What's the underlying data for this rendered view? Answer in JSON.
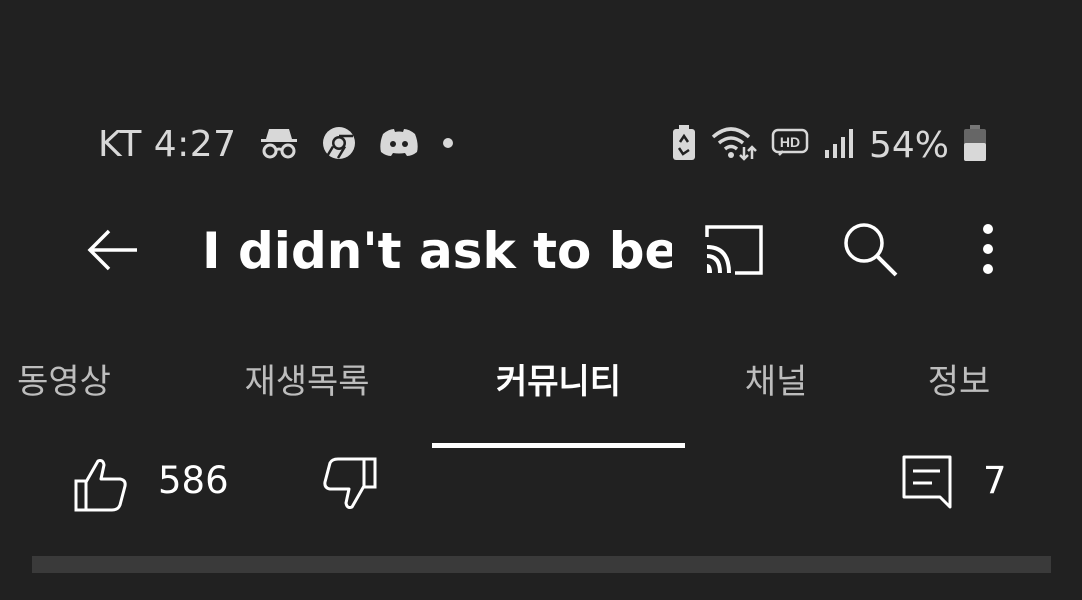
{
  "status_bar": {
    "carrier_time": "KT 4:27",
    "battery_percent": "54%",
    "battery_level": 0.54,
    "icons": [
      "incognito-icon",
      "chrome-icon",
      "discord-icon",
      "dot-icon",
      "battery-saver-icon",
      "wifi-icon",
      "hd-voice-icon",
      "signal-icon",
      "battery-icon"
    ]
  },
  "app_bar": {
    "title": "I didn't ask to be…",
    "icons": [
      "back-arrow-icon",
      "cast-icon",
      "search-icon",
      "more-vert-icon"
    ]
  },
  "tabs": {
    "items": [
      {
        "label": "동영상",
        "active": false
      },
      {
        "label": "재생목록",
        "active": false
      },
      {
        "label": "커뮤니티",
        "active": true
      },
      {
        "label": "채널",
        "active": false
      },
      {
        "label": "정보",
        "active": false
      }
    ]
  },
  "post_actions": {
    "like_count": "586",
    "comment_count": "7",
    "icons": [
      "thumbs-up-icon",
      "thumbs-down-icon",
      "comment-icon"
    ]
  },
  "colors": {
    "background": "#212121",
    "text": "#ffffff",
    "muted_text": "#bdbdbd",
    "status_text": "#d8d8d8",
    "indicator": "#ffffff"
  }
}
